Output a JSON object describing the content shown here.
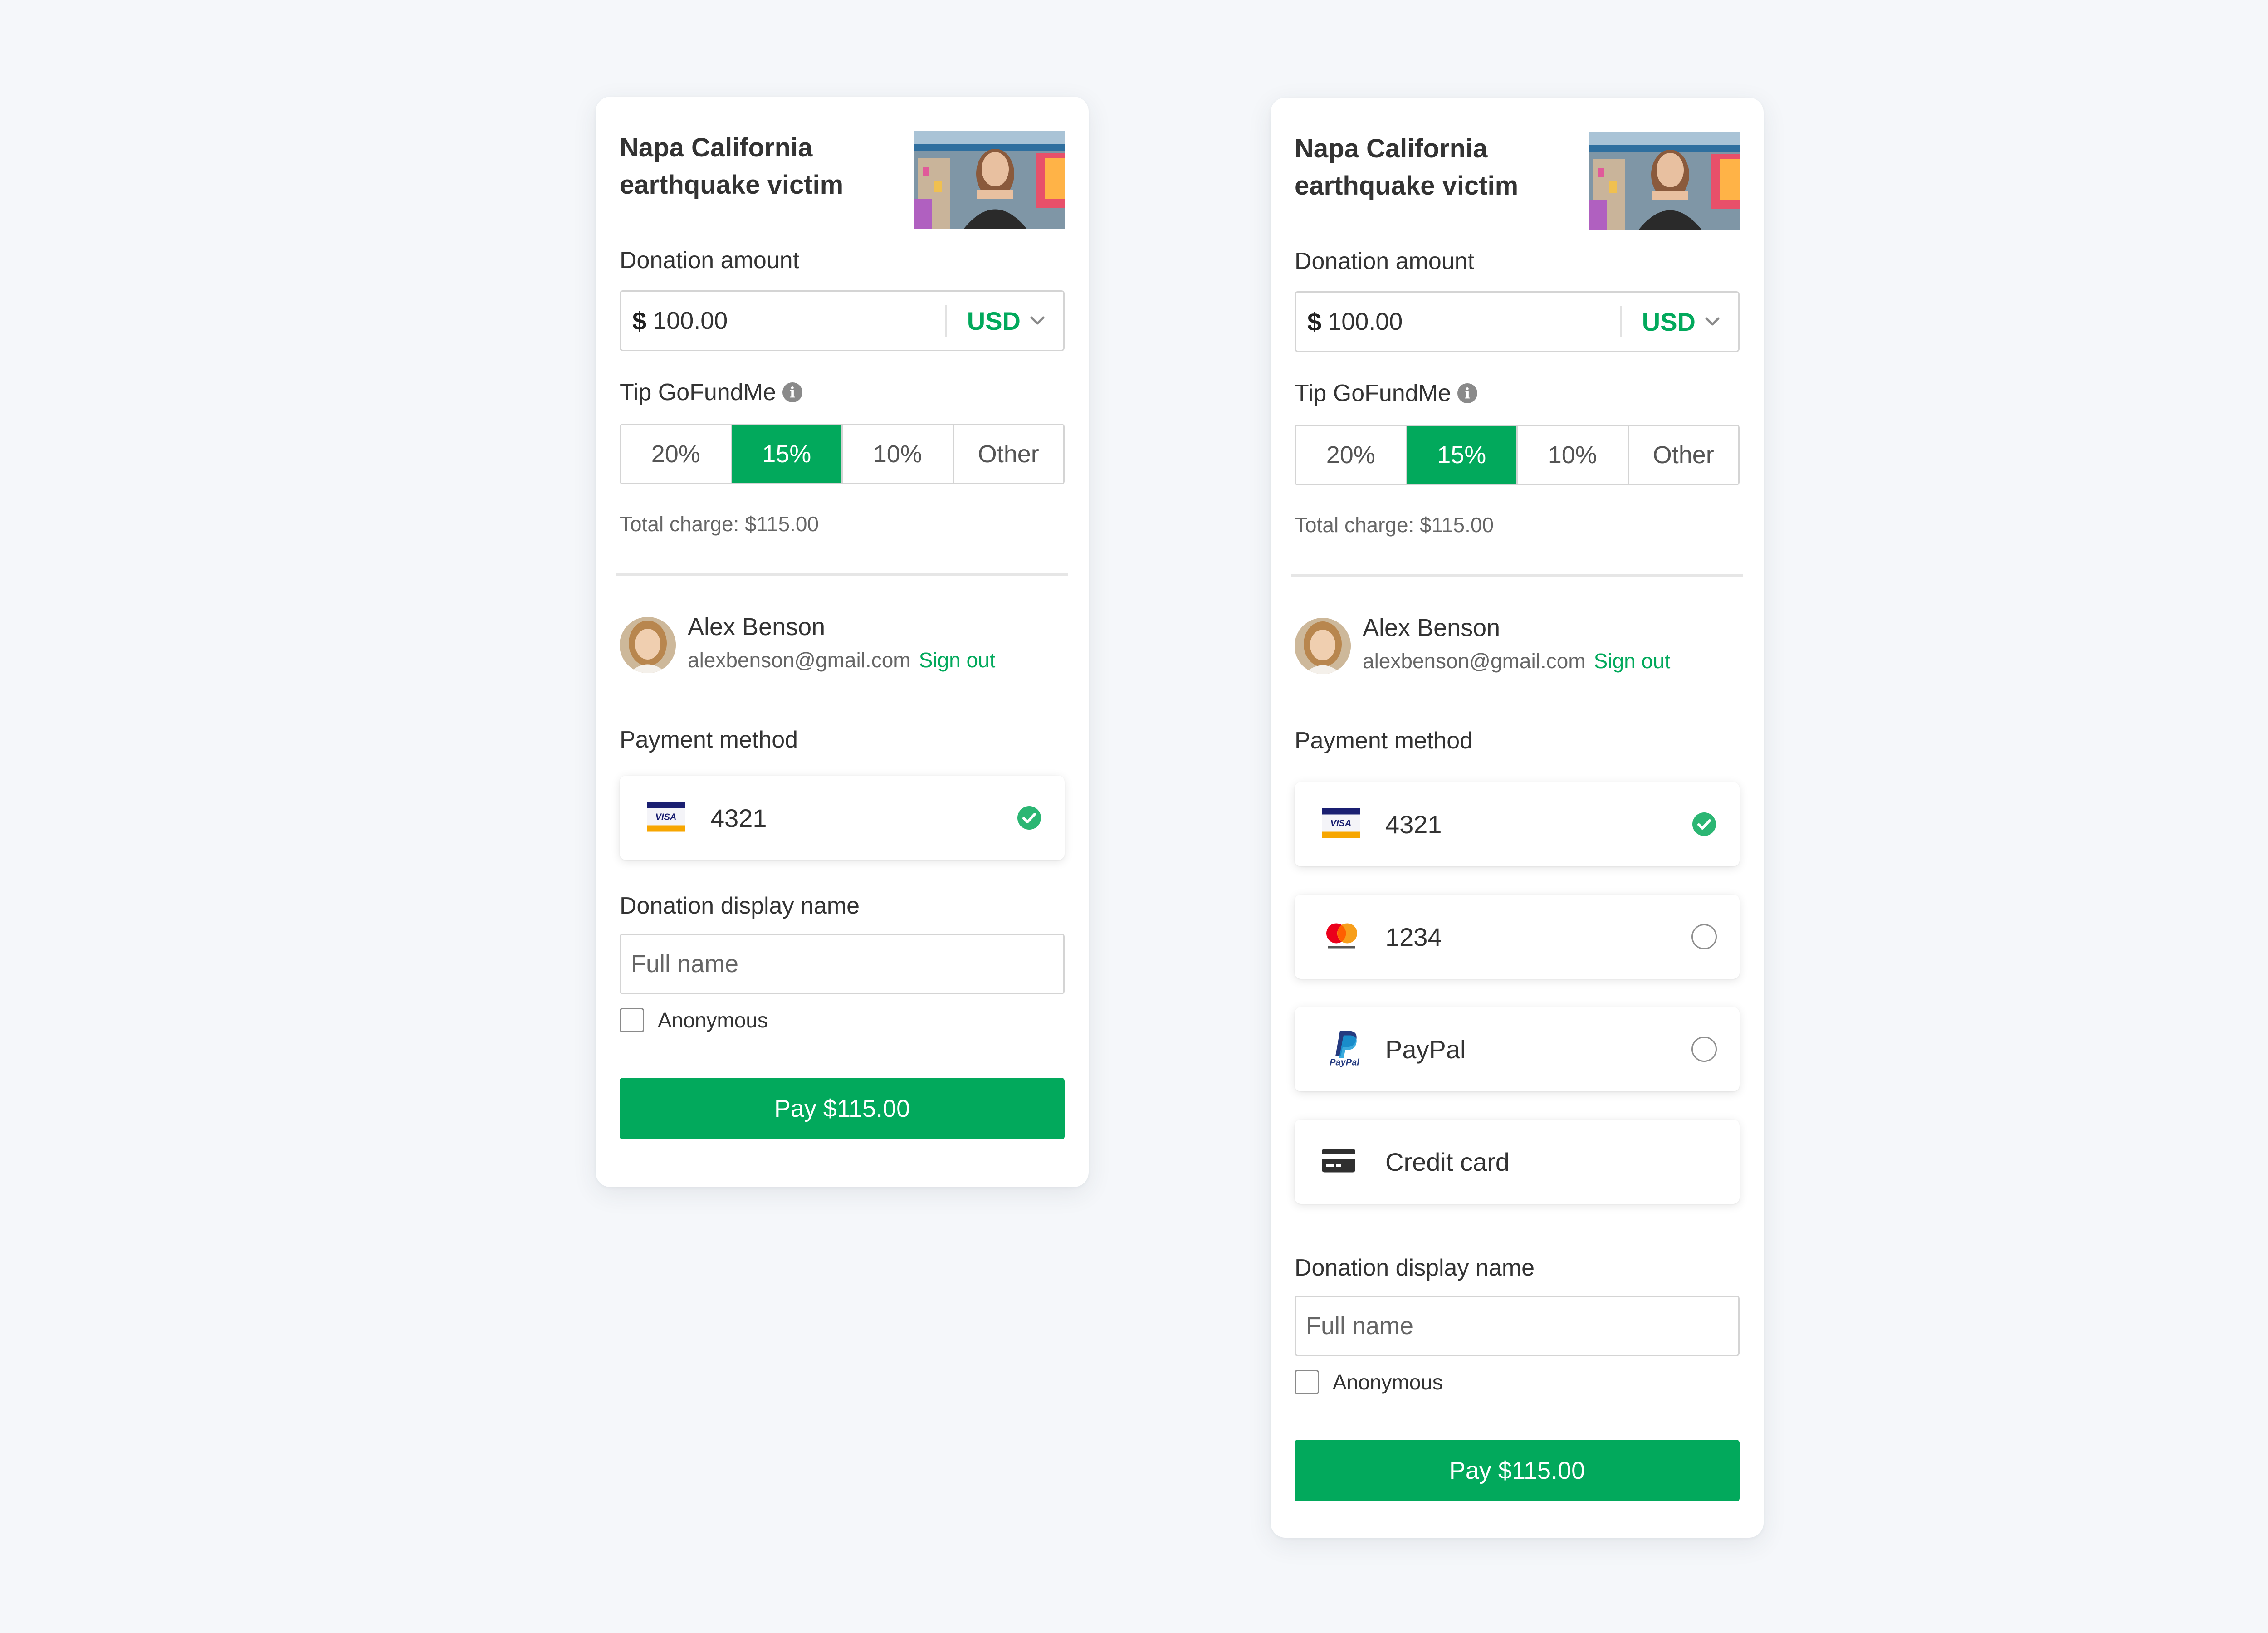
{
  "cards": [
    {
      "campaign_title": "Napa California earthquake victim",
      "donation_amount_label": "Donation amount",
      "currency_symbol": "$",
      "amount_value": "100.00",
      "currency": "USD",
      "tip_label": "Tip GoFundMe",
      "tip_options": [
        "20%",
        "15%",
        "10%",
        "Other"
      ],
      "tip_selected": "15%",
      "total_charge": "Total charge: $115.00",
      "user": {
        "name": "Alex Benson",
        "email": "alexbenson@gmail.com",
        "sign_out": "Sign out"
      },
      "payment_method_label": "Payment method",
      "payment_methods": [
        {
          "brand": "visa-card-icon",
          "label": "4321",
          "selected": true
        }
      ],
      "display_name_label": "Donation display name",
      "full_name_placeholder": "Full name",
      "anonymous_label": "Anonymous",
      "anonymous_checked": false,
      "pay_button_label": "Pay $115.00"
    },
    {
      "campaign_title": "Napa California earthquake victim",
      "donation_amount_label": "Donation amount",
      "currency_symbol": "$",
      "amount_value": "100.00",
      "currency": "USD",
      "tip_label": "Tip GoFundMe",
      "tip_options": [
        "20%",
        "15%",
        "10%",
        "Other"
      ],
      "tip_selected": "15%",
      "total_charge": "Total charge: $115.00",
      "user": {
        "name": "Alex Benson",
        "email": "alexbenson@gmail.com",
        "sign_out": "Sign out"
      },
      "payment_method_label": "Payment method",
      "payment_methods": [
        {
          "brand": "visa-card-icon",
          "label": "4321",
          "selected": true
        },
        {
          "brand": "mastercard-icon",
          "label": "1234",
          "selected": false
        },
        {
          "brand": "paypal-icon",
          "label": "PayPal",
          "selected": false
        },
        {
          "brand": "credit-card-icon",
          "label": "Credit card",
          "selected": null
        }
      ],
      "display_name_label": "Donation display name",
      "full_name_placeholder": "Full name",
      "anonymous_label": "Anonymous",
      "anonymous_checked": false,
      "pay_button_label": "Pay $115.00"
    }
  ],
  "colors": {
    "accent": "#02a95c",
    "page_background": "#f5f7fa",
    "border": "#d4d4d4",
    "text": "#333333",
    "muted_text": "#666666"
  }
}
